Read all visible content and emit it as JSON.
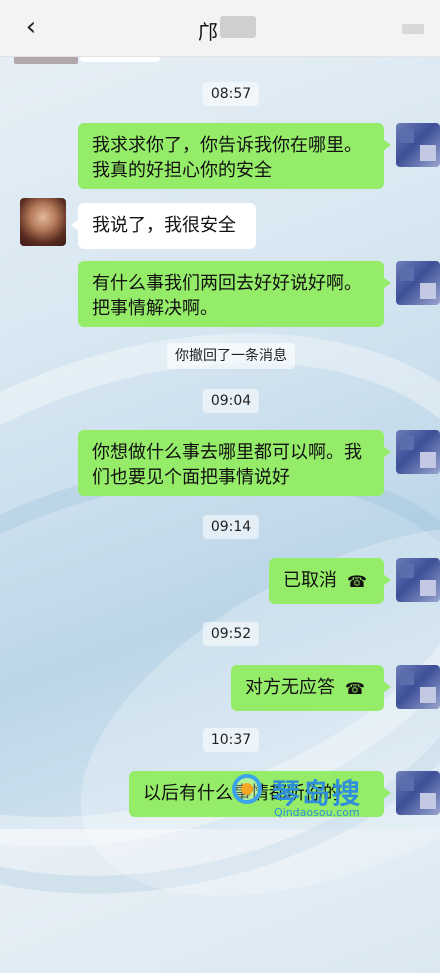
{
  "header": {
    "title": "邝",
    "back_icon": "chevron-left-icon"
  },
  "messages": [
    {
      "type": "time",
      "text": "08:57"
    },
    {
      "type": "out",
      "text": "我求求你了，你告诉我你在哪里。我真的好担心你的安全"
    },
    {
      "type": "in",
      "text": "我说了，我很安全"
    },
    {
      "type": "out",
      "text": "有什么事我们两回去好好说好啊。把事情解决啊。"
    },
    {
      "type": "notice",
      "text": "你撤回了一条消息"
    },
    {
      "type": "time",
      "text": "09:04"
    },
    {
      "type": "out",
      "text": "你想做什么事去哪里都可以啊。我们也要见个面把事情说好"
    },
    {
      "type": "time",
      "text": "09:14"
    },
    {
      "type": "out_call",
      "text": "已取消"
    },
    {
      "type": "time",
      "text": "09:52"
    },
    {
      "type": "out_call",
      "text": "对方无应答"
    },
    {
      "type": "time",
      "text": "10:37"
    },
    {
      "type": "out",
      "text": "以后有什么事情都听你的"
    }
  ],
  "watermark": {
    "brand": "琴岛搜",
    "url": "Qindaosou.com"
  },
  "colors": {
    "outgoing_bubble": "#95ec69",
    "incoming_bubble": "#ffffff"
  }
}
